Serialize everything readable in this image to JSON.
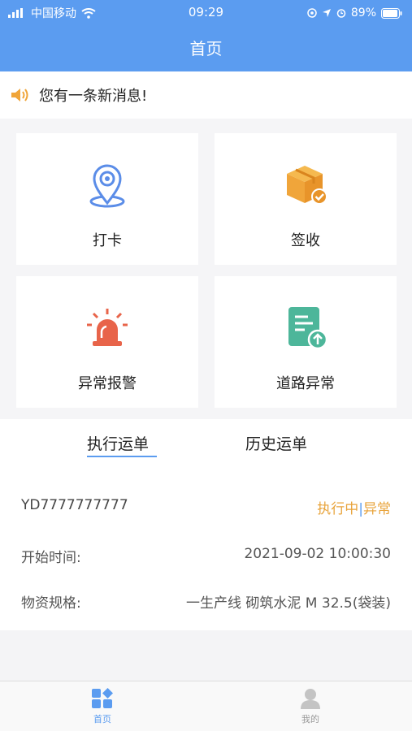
{
  "status_bar": {
    "carrier": "中国移动",
    "time": "09:29",
    "battery": "89%"
  },
  "header": {
    "title": "首页"
  },
  "notice": {
    "text": "您有一条新消息!"
  },
  "actions": [
    {
      "label": "打卡",
      "icon": "location-pin-icon",
      "color": "#5b8de8"
    },
    {
      "label": "签收",
      "icon": "package-check-icon",
      "color": "#f0a53a"
    },
    {
      "label": "异常报警",
      "icon": "alarm-light-icon",
      "color": "#e8644a"
    },
    {
      "label": "道路异常",
      "icon": "document-upload-icon",
      "color": "#4db69a"
    }
  ],
  "tabs": {
    "active": "执行运单",
    "history": "历史运单"
  },
  "order": {
    "number": "YD7777777777",
    "status_running": "执行中",
    "status_separator": "|",
    "status_abnormal": "异常",
    "start_label": "开始时间:",
    "start_value": "2021-09-02 10:00:30",
    "spec_label": "物资规格:",
    "spec_value": "一生产线 砌筑水泥 M 32.5(袋装)"
  },
  "tabbar": {
    "home": "首页",
    "mine": "我的"
  },
  "colors": {
    "primary": "#5b9cf0",
    "warning": "#e8a33a"
  }
}
